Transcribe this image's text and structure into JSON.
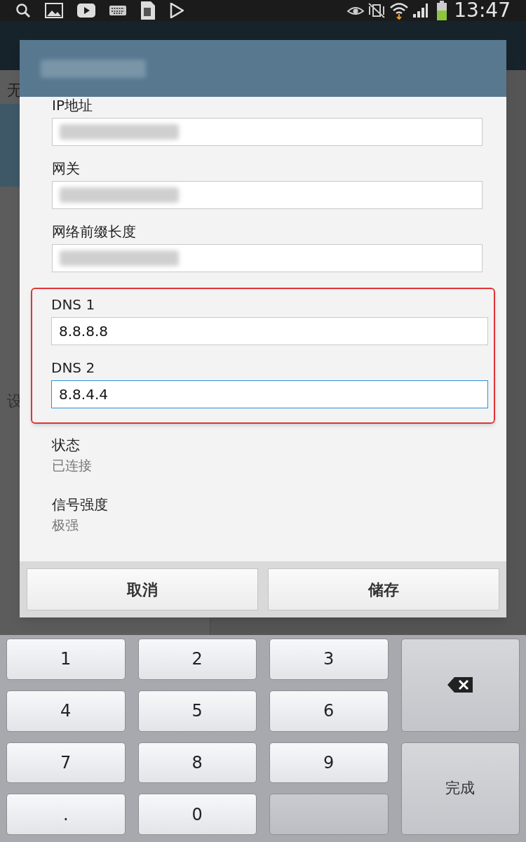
{
  "status_bar": {
    "time": "13:47"
  },
  "background": {
    "texts": [
      "无",
      "设"
    ]
  },
  "dialog": {
    "title": {
      "kind": "blurred"
    },
    "fields": [
      {
        "label": "IP地址",
        "kind": "blurred"
      },
      {
        "label": "网关",
        "kind": "blurred"
      },
      {
        "label": "网络前缀长度",
        "kind": "blurred"
      }
    ],
    "dns_group": {
      "fields": [
        {
          "label": "DNS 1",
          "value": "8.8.8.8",
          "focused": false
        },
        {
          "label": "DNS 2",
          "value": "8.8.4.4",
          "focused": true
        }
      ]
    },
    "info": [
      {
        "label": "状态",
        "value": "已连接"
      },
      {
        "label": "信号强度",
        "value": "极强"
      }
    ],
    "buttons": [
      "取消",
      "储存"
    ]
  },
  "keyboard": {
    "keys": [
      {
        "kind": "char",
        "label": "1"
      },
      {
        "kind": "char",
        "label": "2"
      },
      {
        "kind": "char",
        "label": "3"
      },
      {
        "kind": "backspace"
      },
      {
        "kind": "char",
        "label": "4"
      },
      {
        "kind": "char",
        "label": "5"
      },
      {
        "kind": "char",
        "label": "6"
      },
      {
        "kind": "char",
        "label": "7"
      },
      {
        "kind": "char",
        "label": "8"
      },
      {
        "kind": "char",
        "label": "9"
      },
      {
        "kind": "done",
        "label": "完成"
      },
      {
        "kind": "char",
        "label": "."
      },
      {
        "kind": "char",
        "label": "0"
      },
      {
        "kind": "blank"
      }
    ]
  }
}
